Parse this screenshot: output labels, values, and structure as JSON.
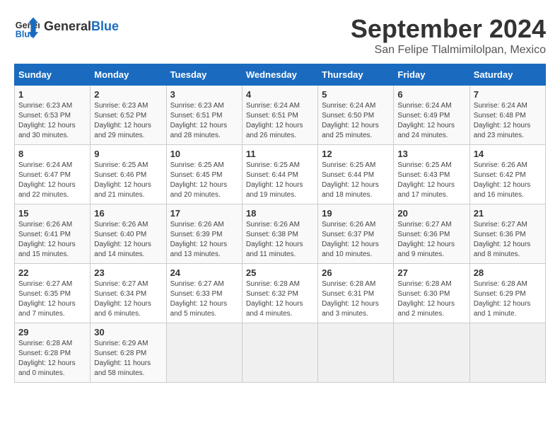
{
  "header": {
    "logo_line1": "General",
    "logo_line2": "Blue",
    "month": "September 2024",
    "location": "San Felipe Tlalmimilolpan, Mexico"
  },
  "weekdays": [
    "Sunday",
    "Monday",
    "Tuesday",
    "Wednesday",
    "Thursday",
    "Friday",
    "Saturday"
  ],
  "weeks": [
    [
      {
        "day": "1",
        "info": "Sunrise: 6:23 AM\nSunset: 6:53 PM\nDaylight: 12 hours and 30 minutes."
      },
      {
        "day": "2",
        "info": "Sunrise: 6:23 AM\nSunset: 6:52 PM\nDaylight: 12 hours and 29 minutes."
      },
      {
        "day": "3",
        "info": "Sunrise: 6:23 AM\nSunset: 6:51 PM\nDaylight: 12 hours and 28 minutes."
      },
      {
        "day": "4",
        "info": "Sunrise: 6:24 AM\nSunset: 6:51 PM\nDaylight: 12 hours and 26 minutes."
      },
      {
        "day": "5",
        "info": "Sunrise: 6:24 AM\nSunset: 6:50 PM\nDaylight: 12 hours and 25 minutes."
      },
      {
        "day": "6",
        "info": "Sunrise: 6:24 AM\nSunset: 6:49 PM\nDaylight: 12 hours and 24 minutes."
      },
      {
        "day": "7",
        "info": "Sunrise: 6:24 AM\nSunset: 6:48 PM\nDaylight: 12 hours and 23 minutes."
      }
    ],
    [
      {
        "day": "8",
        "info": "Sunrise: 6:24 AM\nSunset: 6:47 PM\nDaylight: 12 hours and 22 minutes."
      },
      {
        "day": "9",
        "info": "Sunrise: 6:25 AM\nSunset: 6:46 PM\nDaylight: 12 hours and 21 minutes."
      },
      {
        "day": "10",
        "info": "Sunrise: 6:25 AM\nSunset: 6:45 PM\nDaylight: 12 hours and 20 minutes."
      },
      {
        "day": "11",
        "info": "Sunrise: 6:25 AM\nSunset: 6:44 PM\nDaylight: 12 hours and 19 minutes."
      },
      {
        "day": "12",
        "info": "Sunrise: 6:25 AM\nSunset: 6:44 PM\nDaylight: 12 hours and 18 minutes."
      },
      {
        "day": "13",
        "info": "Sunrise: 6:25 AM\nSunset: 6:43 PM\nDaylight: 12 hours and 17 minutes."
      },
      {
        "day": "14",
        "info": "Sunrise: 6:26 AM\nSunset: 6:42 PM\nDaylight: 12 hours and 16 minutes."
      }
    ],
    [
      {
        "day": "15",
        "info": "Sunrise: 6:26 AM\nSunset: 6:41 PM\nDaylight: 12 hours and 15 minutes."
      },
      {
        "day": "16",
        "info": "Sunrise: 6:26 AM\nSunset: 6:40 PM\nDaylight: 12 hours and 14 minutes."
      },
      {
        "day": "17",
        "info": "Sunrise: 6:26 AM\nSunset: 6:39 PM\nDaylight: 12 hours and 13 minutes."
      },
      {
        "day": "18",
        "info": "Sunrise: 6:26 AM\nSunset: 6:38 PM\nDaylight: 12 hours and 11 minutes."
      },
      {
        "day": "19",
        "info": "Sunrise: 6:26 AM\nSunset: 6:37 PM\nDaylight: 12 hours and 10 minutes."
      },
      {
        "day": "20",
        "info": "Sunrise: 6:27 AM\nSunset: 6:36 PM\nDaylight: 12 hours and 9 minutes."
      },
      {
        "day": "21",
        "info": "Sunrise: 6:27 AM\nSunset: 6:36 PM\nDaylight: 12 hours and 8 minutes."
      }
    ],
    [
      {
        "day": "22",
        "info": "Sunrise: 6:27 AM\nSunset: 6:35 PM\nDaylight: 12 hours and 7 minutes."
      },
      {
        "day": "23",
        "info": "Sunrise: 6:27 AM\nSunset: 6:34 PM\nDaylight: 12 hours and 6 minutes."
      },
      {
        "day": "24",
        "info": "Sunrise: 6:27 AM\nSunset: 6:33 PM\nDaylight: 12 hours and 5 minutes."
      },
      {
        "day": "25",
        "info": "Sunrise: 6:28 AM\nSunset: 6:32 PM\nDaylight: 12 hours and 4 minutes."
      },
      {
        "day": "26",
        "info": "Sunrise: 6:28 AM\nSunset: 6:31 PM\nDaylight: 12 hours and 3 minutes."
      },
      {
        "day": "27",
        "info": "Sunrise: 6:28 AM\nSunset: 6:30 PM\nDaylight: 12 hours and 2 minutes."
      },
      {
        "day": "28",
        "info": "Sunrise: 6:28 AM\nSunset: 6:29 PM\nDaylight: 12 hours and 1 minute."
      }
    ],
    [
      {
        "day": "29",
        "info": "Sunrise: 6:28 AM\nSunset: 6:28 PM\nDaylight: 12 hours and 0 minutes."
      },
      {
        "day": "30",
        "info": "Sunrise: 6:29 AM\nSunset: 6:28 PM\nDaylight: 11 hours and 58 minutes."
      },
      {
        "day": "",
        "info": ""
      },
      {
        "day": "",
        "info": ""
      },
      {
        "day": "",
        "info": ""
      },
      {
        "day": "",
        "info": ""
      },
      {
        "day": "",
        "info": ""
      }
    ]
  ]
}
